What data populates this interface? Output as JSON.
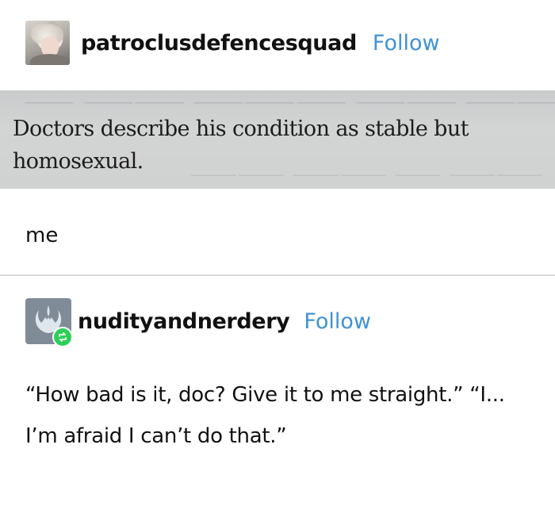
{
  "post1": {
    "username": "patroclusdefencesquad",
    "follow_label": "Follow",
    "book_excerpt": "Doctors describe his condition as stable but homosexual."
  },
  "reply1": {
    "text": "me"
  },
  "post2": {
    "username": "nudityandnerdery",
    "follow_label": "Follow",
    "text": "“How bad is it, doc? Give it to me straight.” “I... I’m afraid I can’t do that.”"
  },
  "icons": {
    "avatar1": "user-avatar-photo",
    "avatar2": "rebel-alliance-icon",
    "reblog": "reblog-icon"
  },
  "colors": {
    "follow": "#3f92d6",
    "reblog_badge": "#2ecf59",
    "divider": "#d9d9d9"
  }
}
